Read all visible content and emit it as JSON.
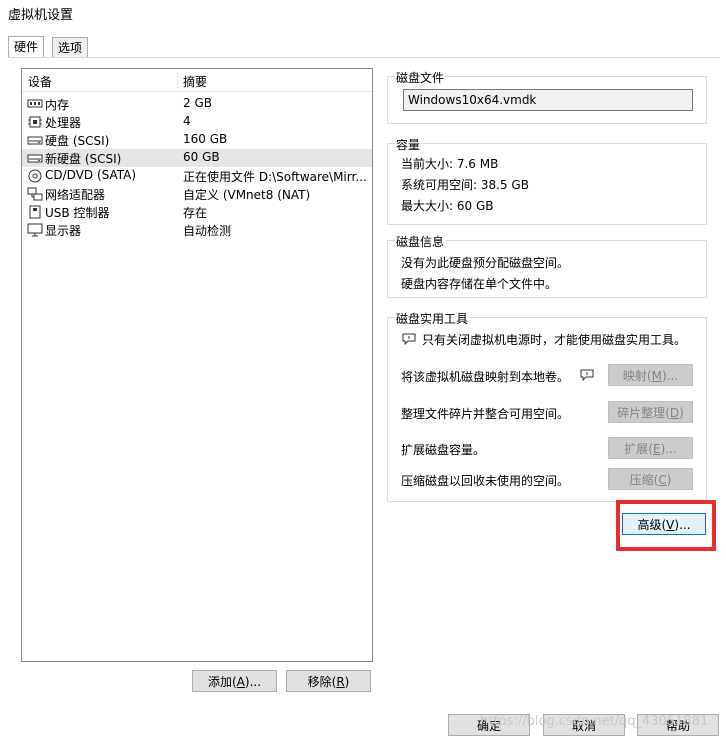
{
  "window": {
    "title": "虚拟机设置"
  },
  "tabs": [
    {
      "label": "硬件",
      "active": true
    },
    {
      "label": "选项",
      "active": false
    }
  ],
  "device_list": {
    "headers": {
      "device": "设备",
      "summary": "摘要"
    },
    "rows": [
      {
        "name": "内存",
        "value": "2 GB",
        "icon": "memory-icon"
      },
      {
        "name": "处理器",
        "value": "4",
        "icon": "cpu-icon"
      },
      {
        "name": "硬盘 (SCSI)",
        "value": "160 GB",
        "icon": "harddisk-icon"
      },
      {
        "name": "新硬盘 (SCSI)",
        "value": "60 GB",
        "icon": "harddisk-icon",
        "selected": true
      },
      {
        "name": "CD/DVD (SATA)",
        "value": "正在使用文件 D:\\Software\\Mirr...",
        "icon": "cd-dvd-icon"
      },
      {
        "name": "网络适配器",
        "value": "自定义 (VMnet8 (NAT)",
        "icon": "network-icon"
      },
      {
        "name": "USB 控制器",
        "value": "存在",
        "icon": "usb-icon"
      },
      {
        "name": "显示器",
        "value": "自动检测",
        "icon": "monitor-icon"
      }
    ],
    "add_button": {
      "label": "添加",
      "key": "A",
      "suffix": "..."
    },
    "remove_button": {
      "label": "移除",
      "key": "R"
    }
  },
  "disk_file": {
    "title": "磁盘文件",
    "value": "Windows10x64.vmdk"
  },
  "capacity": {
    "title": "容量",
    "current": "当前大小: 7.6 MB",
    "available": "系统可用空间: 38.5 GB",
    "max": "最大大小: 60 GB"
  },
  "disk_info": {
    "title": "磁盘信息",
    "line1": "没有为此硬盘预分配磁盘空间。",
    "line2": "硬盘内容存储在单个文件中。"
  },
  "utilities": {
    "title": "磁盘实用工具",
    "note": "只有关闭虚拟机电源时，才能使用磁盘实用工具。",
    "map_text": "将该虚拟机磁盘映射到本地卷。",
    "map_button": {
      "label": "映射",
      "key": "M",
      "suffix": "..."
    },
    "defrag_text": "整理文件碎片并整合可用空间。",
    "defrag_button": {
      "label": "碎片整理",
      "key": "D"
    },
    "expand_text": "扩展磁盘容量。",
    "expand_button": {
      "label": "扩展",
      "key": "E",
      "suffix": "..."
    },
    "compact_text": "压缩磁盘以回收未使用的空间。",
    "compact_button": {
      "label": "压缩",
      "key": "C"
    }
  },
  "advanced_button": {
    "label": "高级",
    "key": "V",
    "suffix": "..."
  },
  "footer": {
    "ok": "确定",
    "cancel": "取消",
    "help": "帮助"
  },
  "watermark": "https://blog.csdn.net/qq_43051881",
  "colors": {
    "highlight": "#e63030",
    "selection": "#e5e5e5"
  }
}
